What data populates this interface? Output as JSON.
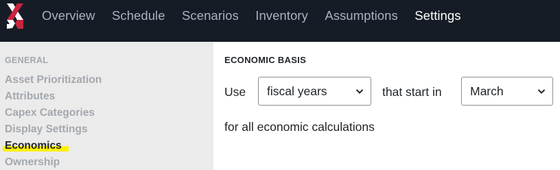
{
  "nav": {
    "logo_icon": "app-logo-icon",
    "items": [
      {
        "label": "Overview"
      },
      {
        "label": "Schedule"
      },
      {
        "label": "Scenarios"
      },
      {
        "label": "Inventory"
      },
      {
        "label": "Assumptions"
      },
      {
        "label": "Settings",
        "active": true
      }
    ]
  },
  "sidebar": {
    "heading": "GENERAL",
    "items": [
      {
        "label": "Asset Prioritization"
      },
      {
        "label": "Attributes"
      },
      {
        "label": "Capex Categories"
      },
      {
        "label": "Display Settings"
      },
      {
        "label": "Economics",
        "active": true
      },
      {
        "label": "Ownership"
      }
    ]
  },
  "main": {
    "section_title": "ECONOMIC BASIS",
    "use_label": "Use",
    "year_type_select": {
      "value": "fiscal years"
    },
    "start_label": "that start in",
    "month_select": {
      "value": "March"
    },
    "footer_text": "for all economic calculations"
  },
  "colors": {
    "nav_bg": "#161c26",
    "nav_text": "#a9b2bf",
    "nav_active": "#ffffff",
    "sidebar_bg": "#ebebeb",
    "highlight": "#fff200",
    "logo_red": "#c8253c"
  }
}
